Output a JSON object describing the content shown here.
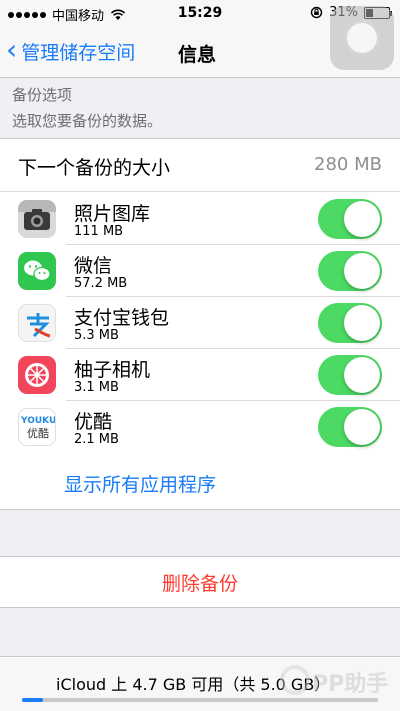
{
  "status_bar": {
    "carrier": "中国移动",
    "time": "15:29",
    "battery": "31%"
  },
  "nav": {
    "back_label": "管理储存空间",
    "title": "信息"
  },
  "backup_options": {
    "header": "备份选项",
    "subtitle": "选取您要备份的数据。"
  },
  "next_backup": {
    "label": "下一个备份的大小",
    "value": "280 MB"
  },
  "apps": [
    {
      "name": "照片图库",
      "size": "111 MB",
      "icon": "camera-icon",
      "enabled": true
    },
    {
      "name": "微信",
      "size": "57.2 MB",
      "icon": "wechat-icon",
      "enabled": true
    },
    {
      "name": "支付宝钱包",
      "size": "5.3 MB",
      "icon": "alipay-icon",
      "enabled": true
    },
    {
      "name": "柚子相机",
      "size": "3.1 MB",
      "icon": "youzi-camera-icon",
      "enabled": true
    },
    {
      "name": "优酷",
      "size": "2.1 MB",
      "icon": "youku-icon",
      "enabled": true
    }
  ],
  "youku_icon_text": {
    "top": "YOUKU",
    "bottom": "优酷"
  },
  "show_all_label": "显示所有应用程序",
  "delete_label": "删除备份",
  "footer": {
    "storage_text": "iCloud 上 4.7 GB 可用（共 5.0 GB）",
    "used_fraction": 0.06
  },
  "watermark": "PP助手",
  "colors": {
    "accent": "#1a7cf6",
    "toggle_on": "#4cd964",
    "destructive": "#ff3b30"
  }
}
